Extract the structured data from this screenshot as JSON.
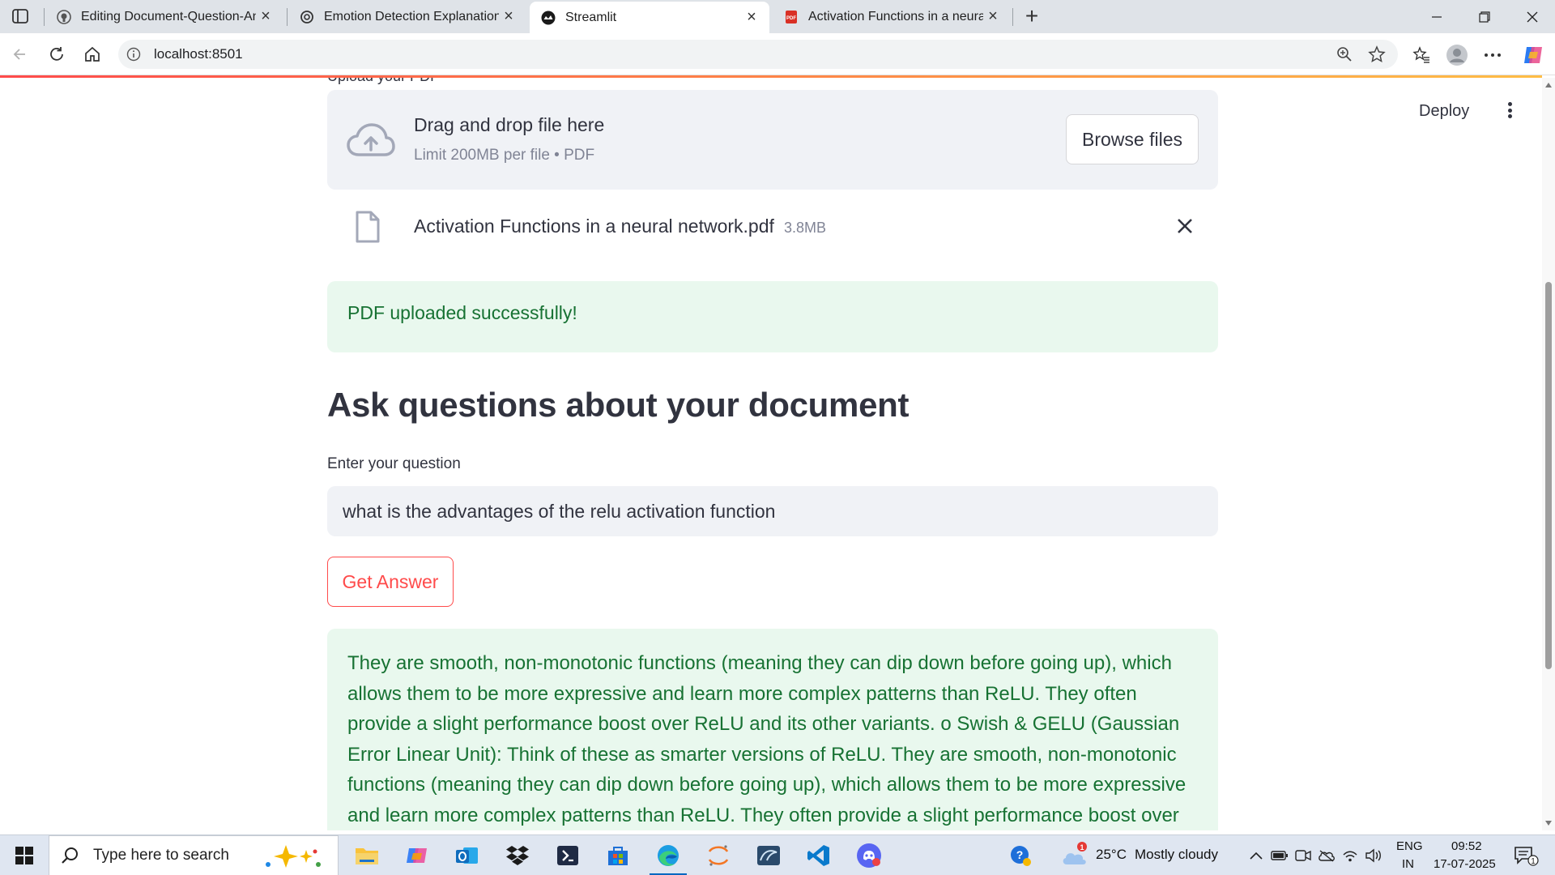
{
  "browser": {
    "tabs": [
      {
        "title": "Editing Document-Question-Answ",
        "icon": "github-icon"
      },
      {
        "title": "Emotion Detection Explanation",
        "icon": "openai-icon"
      },
      {
        "title": "Streamlit",
        "icon": "streamlit-icon",
        "active": true
      },
      {
        "title": "Activation Functions in a neural n",
        "icon": "pdf-icon"
      }
    ],
    "url": "localhost:8501"
  },
  "app": {
    "deploy_label": "Deploy",
    "cut_label": "Upload your PDF",
    "uploader": {
      "title": "Drag and drop file here",
      "limit": "Limit 200MB per file • PDF",
      "browse_label": "Browse files"
    },
    "file": {
      "name": "Activation Functions in a neural network.pdf",
      "size": "3.8MB"
    },
    "success_message": "PDF uploaded successfully!",
    "heading": "Ask questions about your document",
    "question_label": "Enter your question",
    "question_value": "what is the advantages of the relu activation function",
    "button_label": "Get Answer",
    "answer": "They are smooth, non-monotonic functions (meaning they can dip down before going up), which allows them to be more expressive and learn more complex patterns than ReLU. They often provide a slight performance boost over ReLU and its other variants. o Swish & GELU (Gaussian Error Linear Unit): Think of these as smarter versions of ReLU. They are smooth, non-monotonic functions (meaning they can dip down before going up), which allows them to be more expressive and learn more complex patterns than ReLU. They often provide a slight performance boost over ReLU and its",
    "colors": {
      "accent": "#ff4b4b",
      "success_bg": "#e9f8ee",
      "success_text": "#177233"
    }
  },
  "taskbar": {
    "search_placeholder": "Type here to search",
    "weather_temp": "25°C",
    "weather_text": "Mostly cloudy",
    "weather_badge": "1",
    "lang_top": "ENG",
    "lang_bottom": "IN",
    "time": "09:52",
    "date": "17-07-2025",
    "notification_count": "1"
  }
}
